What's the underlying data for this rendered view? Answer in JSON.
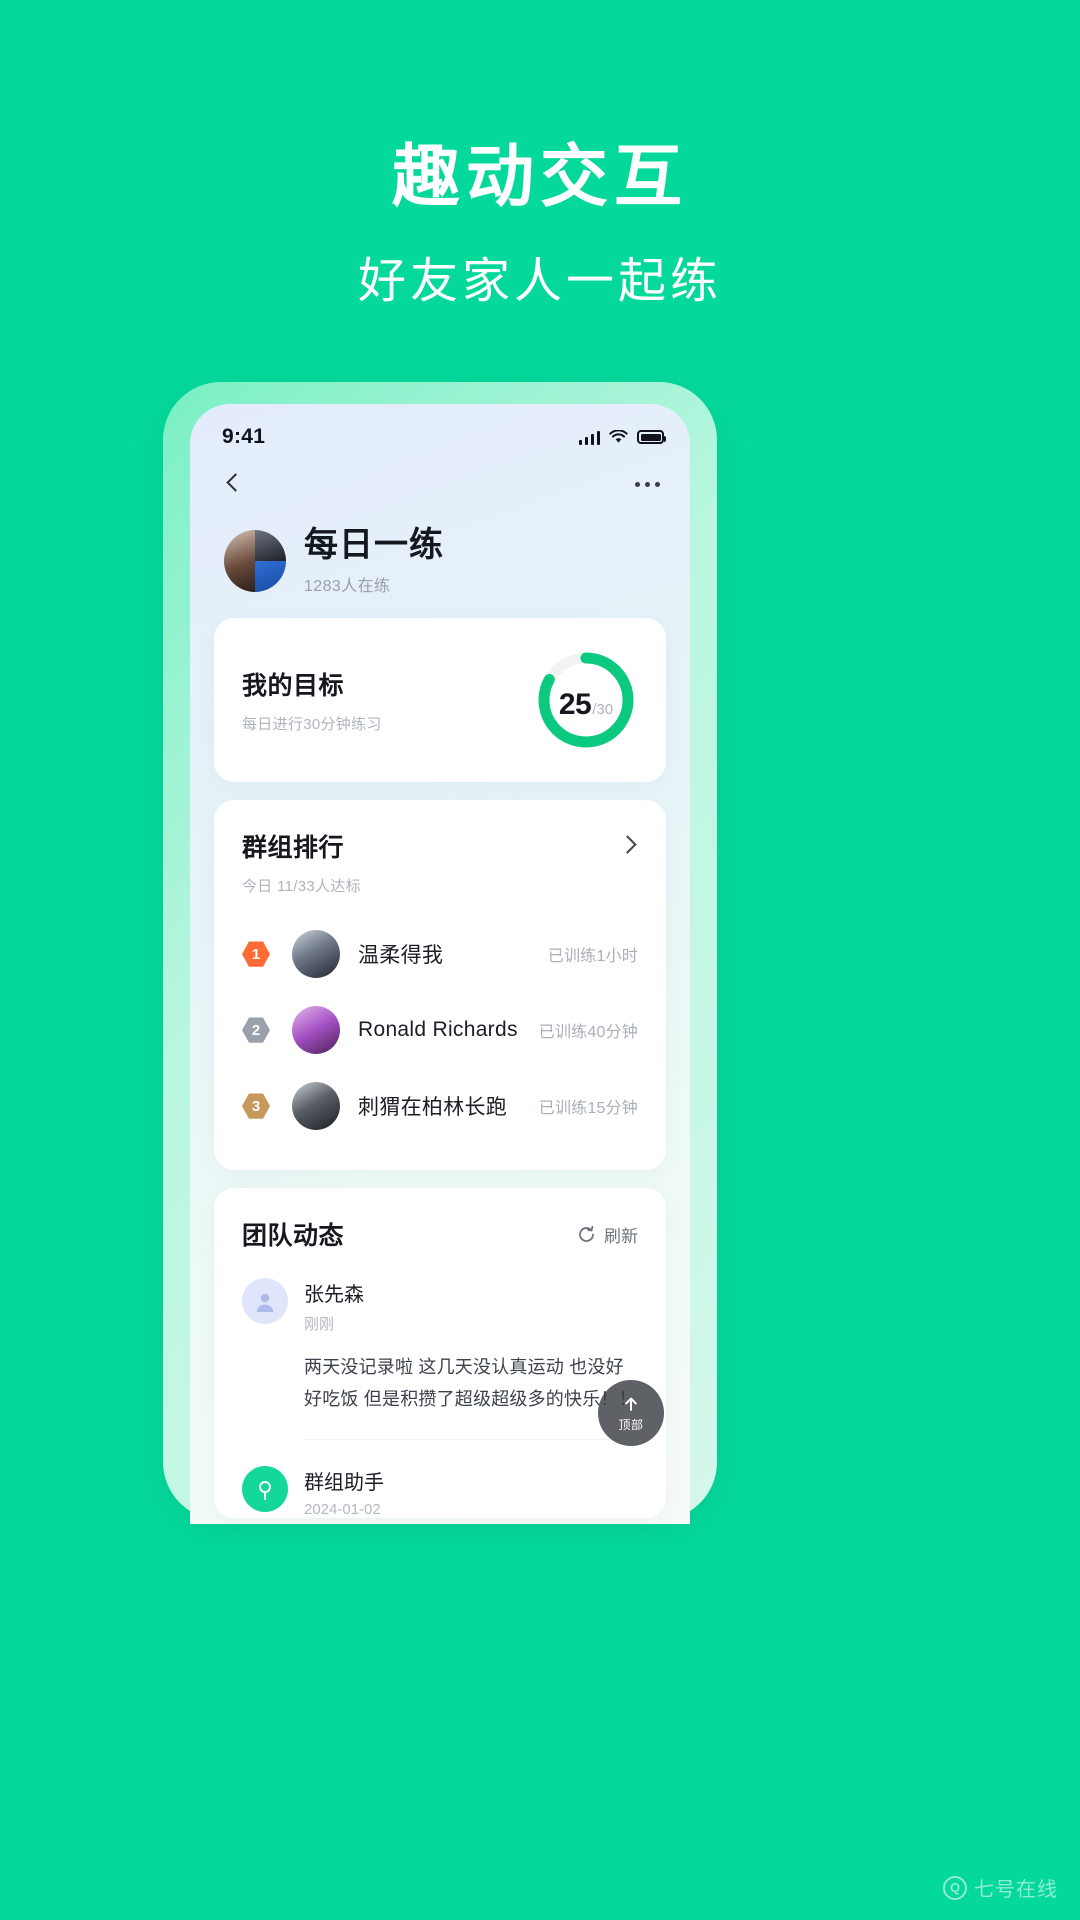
{
  "promo": {
    "title": "趣动交互",
    "subtitle": "好友家人一起练"
  },
  "colors": {
    "background": "#05d89b",
    "accent": "#14d79a",
    "bezel": "#7bf0c4",
    "rank1": "#ff6b35",
    "rank2": "#9aa1ab",
    "rank3": "#c79a5b"
  },
  "status_bar": {
    "time": "9:41",
    "signal_icon": "cellular-bars-icon",
    "wifi_icon": "wifi-icon",
    "battery_icon": "battery-full-icon"
  },
  "navbar": {
    "back_icon": "chevron-left-icon",
    "more_icon": "more-horizontal-icon"
  },
  "group": {
    "title": "每日一练",
    "members": "1283人在练",
    "avatar_icon": "group-avatar-collage"
  },
  "goal": {
    "title": "我的目标",
    "subtitle": "每日进行30分钟练习",
    "progress_value": "25",
    "progress_total": "/30",
    "progress_percent": 83
  },
  "ranking": {
    "title": "群组排行",
    "subtitle": "今日 11/33人达标",
    "chevron_icon": "chevron-right-icon",
    "rows": [
      {
        "rank": "1",
        "name": "温柔得我",
        "time": "已训练1小时"
      },
      {
        "rank": "2",
        "name": "Ronald Richards",
        "time": "已训练40分钟"
      },
      {
        "rank": "3",
        "name": "刺猬在柏林长跑",
        "time": "已训练15分钟"
      }
    ]
  },
  "feed": {
    "title": "团队动态",
    "refresh_label": "刷新",
    "refresh_icon": "refresh-icon",
    "posts": [
      {
        "name": "张先森",
        "meta": "刚刚",
        "text": "两天没记录啦 这几天没认真运动 也没好好吃饭 但是积攒了超级超级多的快乐！！",
        "avatar_icon": "user-avatar-icon"
      },
      {
        "name": "群组助手",
        "meta": "2024-01-02",
        "text": "",
        "avatar_icon": "assistant-avatar-icon"
      }
    ]
  },
  "fab": {
    "label": "顶部",
    "icon": "arrow-up-icon"
  },
  "watermark": {
    "badge": "Q",
    "text": "七号在线"
  }
}
